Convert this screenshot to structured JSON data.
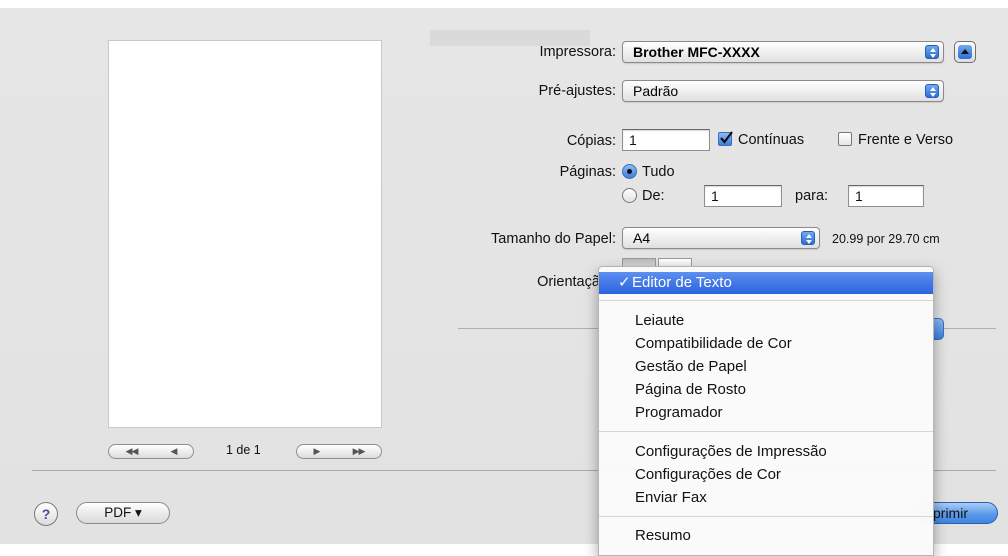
{
  "printer": {
    "label": "Impressora:",
    "value": "Brother MFC-XXXX"
  },
  "presets": {
    "label": "Pré-ajustes:",
    "value": "Padrão"
  },
  "copies": {
    "label": "Cópias:",
    "value": "1",
    "collated_label": "Contínuas",
    "collated_checked": true,
    "duplex_label": "Frente e Verso",
    "duplex_checked": false
  },
  "pages": {
    "label": "Páginas:",
    "all_label": "Tudo",
    "from_label": "De:",
    "from_value": "1",
    "to_label": "para:",
    "to_value": "1",
    "selected": "all"
  },
  "paper_size": {
    "label": "Tamanho do Papel:",
    "value": "A4",
    "dimensions": "20.99 por 29.70 cm"
  },
  "orientation": {
    "label": "Orientação"
  },
  "preview_nav": {
    "page_text": "1 de 1"
  },
  "menu": {
    "selected": "Editor de Texto",
    "group1": [
      "Leiaute",
      "Compatibilidade de Cor",
      "Gestão de Papel",
      "Página de Rosto",
      "Programador"
    ],
    "group2": [
      "Configurações de Impressão",
      "Configurações de Cor",
      "Enviar Fax"
    ],
    "group3": [
      "Resumo"
    ]
  },
  "footer": {
    "help_label": "?",
    "pdf_label": "PDF ▾",
    "print_label": "primir"
  },
  "colors": {
    "accent": "#2a63dd",
    "background": "#e4e4e4"
  }
}
